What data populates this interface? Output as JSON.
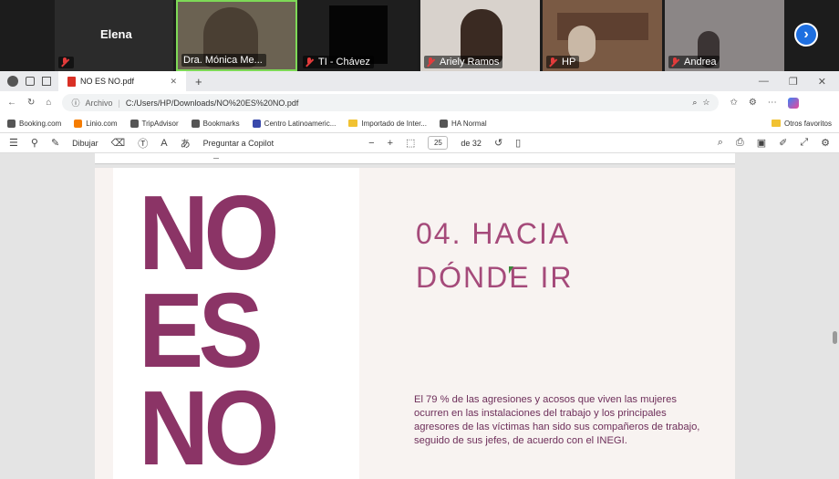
{
  "meeting": {
    "participants": [
      {
        "name": "Elena",
        "avatar_bg": "#2b2b2b"
      },
      {
        "name": "Dra. Mónica Me...",
        "avatar_bg": "#6b6252"
      },
      {
        "name": "TI - Chávez",
        "avatar_bg": "#111111"
      },
      {
        "name": "Ariely Ramos",
        "avatar_bg": "#d8d2cc"
      },
      {
        "name": "HP",
        "avatar_bg": "#7a5a44"
      },
      {
        "name": "Andrea",
        "avatar_bg": "#8b8686"
      }
    ],
    "next_label": "›"
  },
  "browser": {
    "tab_title": "NO ES NO.pdf",
    "new_tab": "+",
    "url_label": "Archivo",
    "url": "C:/Users/HP/Downloads/NO%20ES%20NO.pdf",
    "bookmarks": [
      "Booking.com",
      "Linio.com",
      "TripAdvisor",
      "Bookmarks",
      "Centro Latinoameric...",
      "Importado de Inter...",
      "HA Normal"
    ],
    "other_favorites": "Otros favoritos"
  },
  "pdf_toolbar": {
    "draw_label": "Dibujar",
    "copilot_label": "Preguntar a Copilot",
    "page_current": "25",
    "page_total": "de 32"
  },
  "document": {
    "big_word_1": "NO",
    "big_word_2": "ES",
    "big_word_3": "NO",
    "heading_line_1": "04. HACIA",
    "heading_line_2": "DÓNDE IR",
    "paragraph": "El 79 % de las agresiones y acosos que viven las mujeres ocurren en las instalaciones del trabajo y los principales agresores de las víctimas han sido sus compañeros de trabajo, seguido de sus jefes, de acuerdo con el INEGI.",
    "accent_color": "#8b3466"
  }
}
